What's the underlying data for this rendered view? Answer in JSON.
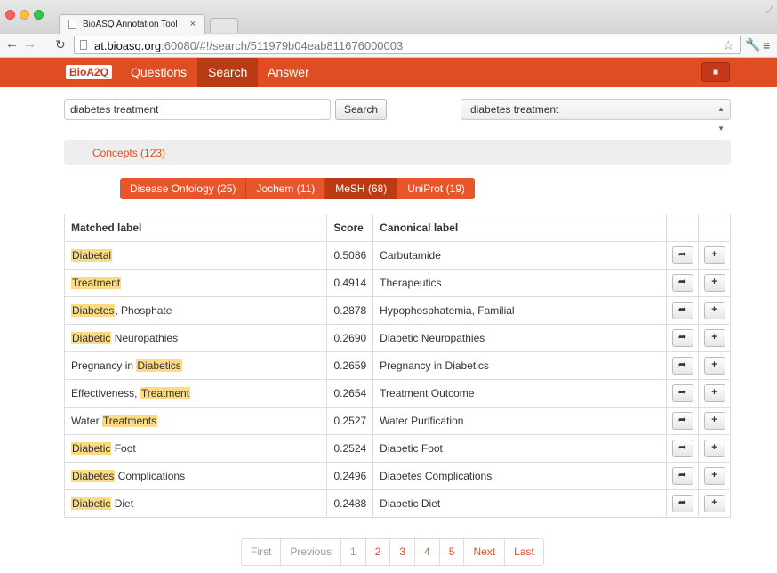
{
  "browser": {
    "tab_title": "BioASQ Annotation Tool",
    "tab_close": "×",
    "url_host": "at.bioasq.org",
    "url_rest": ":60080/#!/search/511979b04eab811676000003"
  },
  "navbar": {
    "logo": "BioA2Q",
    "links": [
      "Questions",
      "Search",
      "Answer"
    ],
    "active": "Search",
    "user_icon": "user-icon"
  },
  "search": {
    "query": "diabetes treatment",
    "button": "Search",
    "select_value": "diabetes treatment"
  },
  "concepts_label": "Concepts (123)",
  "sources": [
    {
      "label": "Disease Ontology (25)",
      "active": false
    },
    {
      "label": "Jochem (11)",
      "active": false
    },
    {
      "label": "MeSH (68)",
      "active": true
    },
    {
      "label": "UniProt (19)",
      "active": false
    }
  ],
  "table": {
    "headers": [
      "Matched label",
      "Score",
      "Canonical label"
    ],
    "rows": [
      {
        "hl": "Diabetal",
        "rest": "",
        "pre": "",
        "score": "0.5086",
        "canonical": "Carbutamide"
      },
      {
        "hl": "Treatment",
        "rest": "",
        "pre": "",
        "score": "0.4914",
        "canonical": "Therapeutics"
      },
      {
        "hl": "Diabetes",
        "rest": ", Phosphate",
        "pre": "",
        "score": "0.2878",
        "canonical": "Hypophosphatemia, Familial"
      },
      {
        "hl": "Diabetic",
        "rest": " Neuropathies",
        "pre": "",
        "score": "0.2690",
        "canonical": "Diabetic Neuropathies"
      },
      {
        "pre": "Pregnancy in ",
        "hl": "Diabetics",
        "rest": "",
        "score": "0.2659",
        "canonical": "Pregnancy in Diabetics"
      },
      {
        "pre": "Effectiveness, ",
        "hl": "Treatment",
        "rest": "",
        "score": "0.2654",
        "canonical": "Treatment Outcome"
      },
      {
        "pre": "Water ",
        "hl": "Treatments",
        "rest": "",
        "score": "0.2527",
        "canonical": "Water Purification"
      },
      {
        "hl": "Diabetic",
        "rest": " Foot",
        "pre": "",
        "score": "0.2524",
        "canonical": "Diabetic Foot"
      },
      {
        "hl": "Diabetes",
        "rest": " Complications",
        "pre": "",
        "score": "0.2496",
        "canonical": "Diabetes Complications"
      },
      {
        "hl": "Diabetic",
        "rest": " Diet",
        "pre": "",
        "score": "0.2488",
        "canonical": "Diabetic Diet"
      }
    ],
    "row_icons": [
      "share-arrow-icon",
      "plus-icon"
    ]
  },
  "pagination": [
    "First",
    "Previous",
    "1",
    "2",
    "3",
    "4",
    "5",
    "Next",
    "Last"
  ],
  "colors": {
    "brand": "#e14d22",
    "highlight": "#fddb85"
  }
}
